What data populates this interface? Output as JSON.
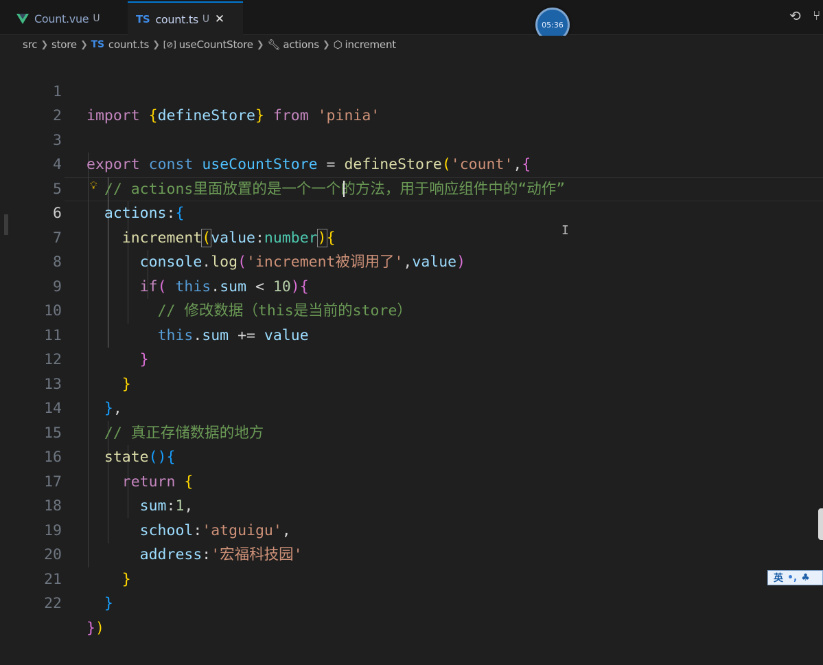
{
  "tabs": [
    {
      "label": "Count.vue",
      "badge": "U",
      "icon": "vue-icon",
      "active": false
    },
    {
      "label": "count.ts",
      "badge": "U",
      "icon": "ts-icon",
      "active": true,
      "close": "✕"
    }
  ],
  "timer": "05:36",
  "breadcrumb": {
    "items": [
      "src",
      "store",
      "count.ts",
      "useCountStore",
      "actions",
      "increment"
    ],
    "ts_badge": "TS",
    "symbol_badge": "[⊘]"
  },
  "ime": {
    "lang": "英",
    "punct": "•,",
    "user": "♣"
  },
  "editor": {
    "active_line": 6,
    "line_numbers": [
      "1",
      "2",
      "3",
      "4",
      "5",
      "6",
      "7",
      "8",
      "9",
      "10",
      "11",
      "12",
      "13",
      "14",
      "15",
      "16",
      "17",
      "18",
      "19",
      "20",
      "21",
      "22"
    ],
    "code": {
      "l1_import": "import",
      "l1_lb": "{",
      "l1_name": "defineStore",
      "l1_rb": "}",
      "l1_from": "from",
      "l1_str": "'pinia'",
      "l3_export": "export",
      "l3_const": "const",
      "l3_name": "useCountStore",
      "l3_eq": " = ",
      "l3_fn": "defineStore",
      "l3_lp": "(",
      "l3_str": "'count'",
      "l3_comma": ",",
      "l3_lb": "{",
      "l4_comment": "// actions里面放置的是一个一个的方法，用于响应组件中的“动作”",
      "l5_actions": "actions",
      "l5_colon": ":",
      "l5_lb": "{",
      "l6_fn": "increment",
      "l6_lp": "(",
      "l6_param": "value",
      "l6_colon": ":",
      "l6_type": "number",
      "l6_rp": ")",
      "l6_lb": "{",
      "l7_console": "console",
      "l7_dot": ".",
      "l7_log": "log",
      "l7_lp": "(",
      "l7_str": "'increment被调用了'",
      "l7_comma": ",",
      "l7_value": "value",
      "l7_rp": ")",
      "l8_if": "if",
      "l8_lp": "(",
      "l8_this": "this",
      "l8_dot": ".",
      "l8_sum": "sum",
      "l8_op": " < ",
      "l8_num": "10",
      "l8_rp": ")",
      "l8_lb": "{",
      "l9_comment": "// 修改数据（this是当前的store）",
      "l10_this": "this",
      "l10_dot": ".",
      "l10_sum": "sum",
      "l10_op": " += ",
      "l10_value": "value",
      "l11_rb": "}",
      "l12_rb": "}",
      "l13_rb": "}",
      "l13_comma": ",",
      "l14_comment": "// 真正存储数据的地方",
      "l15_state": "state",
      "l15_parens": "()",
      "l15_lb": "{",
      "l16_return": "return",
      "l16_lb": "{",
      "l17_key": "sum",
      "l17_colon": ":",
      "l17_num": "1",
      "l17_comma": ",",
      "l18_key": "school",
      "l18_colon": ":",
      "l18_str": "'atguigu'",
      "l18_comma": ",",
      "l19_key": "address",
      "l19_colon": ":",
      "l19_str": "'宏福科技园'",
      "l20_rb": "}",
      "l21_rb": "}",
      "l22_rb": "}",
      "l22_rp": ")"
    }
  }
}
